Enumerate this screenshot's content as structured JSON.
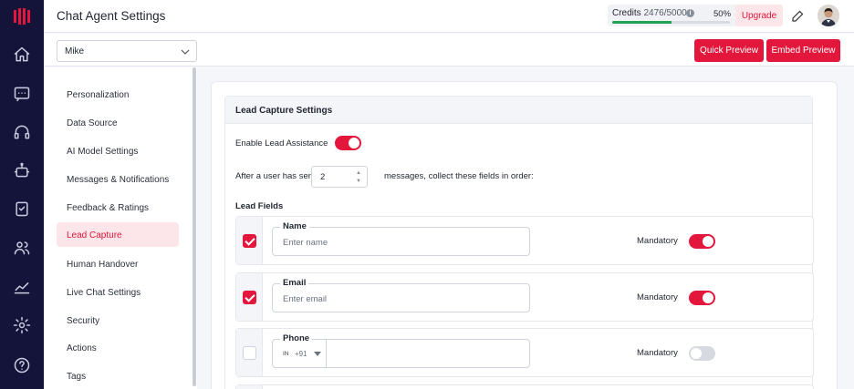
{
  "header": {
    "title": "Chat Agent Settings",
    "credits_label": "Credits",
    "credits_value": "2476/5000",
    "credits_percent": "50%",
    "credits_fraction": 0.5,
    "upgrade_label": "Upgrade"
  },
  "subbar": {
    "agent": "Mike",
    "quick_preview": "Quick Preview",
    "embed_preview": "Embed Preview"
  },
  "nav": {
    "items": [
      {
        "label": "Personalization"
      },
      {
        "label": "Data Source"
      },
      {
        "label": "AI Model Settings"
      },
      {
        "label": "Messages & Notifications"
      },
      {
        "label": "Feedback & Ratings"
      },
      {
        "label": "Lead Capture"
      },
      {
        "label": "Human Handover"
      },
      {
        "label": "Live Chat Settings"
      },
      {
        "label": "Security"
      },
      {
        "label": "Actions"
      },
      {
        "label": "Tags"
      }
    ],
    "active": "Lead Capture"
  },
  "lead": {
    "section_title": "Lead Capture Settings",
    "enable_label": "Enable Lead Assistance",
    "enable_on": true,
    "after_label": "After a user has sent",
    "message_count": "2",
    "after_suffix": "messages, collect these fields in order:",
    "fields_label": "Lead Fields",
    "mandatory_label": "Mandatory",
    "fields": [
      {
        "name": "Name",
        "placeholder": "Enter name",
        "checked": true,
        "mandatory": true
      },
      {
        "name": "Email",
        "placeholder": "Enter email",
        "checked": true,
        "mandatory": true
      },
      {
        "name": "Phone",
        "country": "IN",
        "code": "+91",
        "checked": false,
        "mandatory": false
      }
    ]
  },
  "colors": {
    "accent": "#e3173c",
    "rail": "#14143a",
    "progress": "#22a352"
  }
}
